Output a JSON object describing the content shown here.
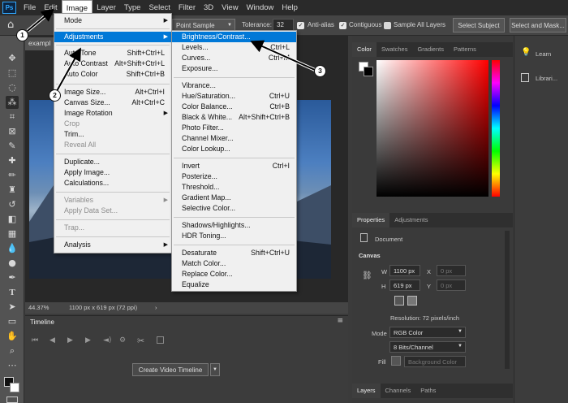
{
  "menubar": {
    "logo": "Ps",
    "items": [
      "File",
      "Edit",
      "Image",
      "Layer",
      "Type",
      "Select",
      "Filter",
      "3D",
      "View",
      "Window",
      "Help"
    ]
  },
  "options": {
    "sample_value": "Point Sample",
    "tolerance_label": "Tolerance:",
    "tolerance_value": "32",
    "anti_alias": "Anti-alias",
    "contiguous": "Contiguous",
    "sample_all_layers": "Sample All Layers",
    "select_subject": "Select Subject",
    "select_and_mask": "Select and Mask..."
  },
  "document": {
    "tab": "exampl",
    "zoom": "44.37%",
    "dims": "1100 px x 619 px (72 ppi)"
  },
  "timeline": {
    "title": "Timeline",
    "create_button": "Create Video Timeline"
  },
  "panels": {
    "color_tabs": [
      "Color",
      "Swatches",
      "Gradients",
      "Patterns"
    ],
    "props_tabs": [
      "Properties",
      "Adjustments"
    ],
    "document_label": "Document",
    "canvas_label": "Canvas",
    "w_label": "W",
    "w_value": "1100 px",
    "h_label": "H",
    "h_value": "619 px",
    "x_label": "X",
    "x_value": "0 px",
    "y_label": "Y",
    "y_value": "0 px",
    "resolution": "Resolution: 72 pixels/inch",
    "mode_label": "Mode",
    "mode_value": "RGB Color",
    "bits_value": "8 Bits/Channel",
    "fill_label": "Fill",
    "fill_value": "Background Color",
    "layers_tabs": [
      "Layers",
      "Channels",
      "Paths"
    ],
    "learn": "Learn",
    "libraries": "Librari..."
  },
  "image_menu": {
    "mode": "Mode",
    "adjustments": "Adjustments",
    "auto_tone": "Auto Tone",
    "auto_tone_sc": "Shift+Ctrl+L",
    "auto_contrast": "Auto Contrast",
    "auto_contrast_sc": "Alt+Shift+Ctrl+L",
    "auto_color": "Auto Color",
    "auto_color_sc": "Shift+Ctrl+B",
    "image_size": "Image Size...",
    "image_size_sc": "Alt+Ctrl+I",
    "canvas_size": "Canvas Size...",
    "canvas_size_sc": "Alt+Ctrl+C",
    "image_rotation": "Image Rotation",
    "crop": "Crop",
    "trim": "Trim...",
    "reveal_all": "Reveal All",
    "duplicate": "Duplicate...",
    "apply_image": "Apply Image...",
    "calculations": "Calculations...",
    "variables": "Variables",
    "apply_data_set": "Apply Data Set...",
    "trap": "Trap...",
    "analysis": "Analysis"
  },
  "adj_menu": {
    "brightness_contrast": "Brightness/Contrast...",
    "levels": "Levels...",
    "levels_sc": "Ctrl+L",
    "curves": "Curves...",
    "curves_sc": "Ctrl+M",
    "exposure": "Exposure...",
    "vibrance": "Vibrance...",
    "hue_saturation": "Hue/Saturation...",
    "hue_saturation_sc": "Ctrl+U",
    "color_balance": "Color Balance...",
    "color_balance_sc": "Ctrl+B",
    "black_white": "Black & White...",
    "black_white_sc": "Alt+Shift+Ctrl+B",
    "photo_filter": "Photo Filter...",
    "channel_mixer": "Channel Mixer...",
    "color_lookup": "Color Lookup...",
    "invert": "Invert",
    "invert_sc": "Ctrl+I",
    "posterize": "Posterize...",
    "threshold": "Threshold...",
    "gradient_map": "Gradient Map...",
    "selective_color": "Selective Color...",
    "shadows_highlights": "Shadows/Highlights...",
    "hdr_toning": "HDR Toning...",
    "desaturate": "Desaturate",
    "desaturate_sc": "Shift+Ctrl+U",
    "match_color": "Match Color...",
    "replace_color": "Replace Color...",
    "equalize": "Equalize"
  },
  "callouts": [
    "1",
    "2",
    "3"
  ],
  "colors": {
    "highlight": "#0078d7",
    "accent": "#31a8ff"
  }
}
